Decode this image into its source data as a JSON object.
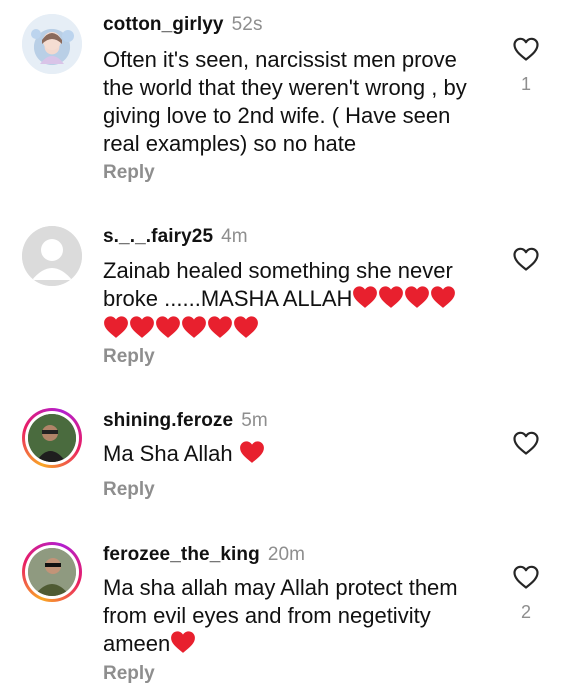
{
  "comments": [
    {
      "username": "cotton_girlyy",
      "time": "52s",
      "text_lines": [
        "Often it's seen, narcissist men prove",
        "the world that they weren't wrong , by",
        "giving love to 2nd wife. ( Have seen",
        "real examples) so no hate"
      ],
      "reply_label": "Reply",
      "like_count": "1"
    },
    {
      "username": "s._._.fairy25",
      "time": "4m",
      "text_line1": "Zainab healed something she never",
      "text_line2": "broke ......MASHA ALLAH",
      "reply_label": "Reply",
      "like_count": ""
    },
    {
      "username": "shining.feroze",
      "time": "5m",
      "text": "Ma Sha Allah",
      "reply_label": "Reply",
      "like_count": ""
    },
    {
      "username": "ferozee_the_king",
      "time": "20m",
      "text_lines": [
        "Ma sha allah may Allah protect them",
        "from evil eyes and from negetivity"
      ],
      "text_last": "ameen",
      "reply_label": "Reply",
      "like_count": "2"
    }
  ],
  "colors": {
    "heart_emoji": "#e8202e",
    "muted": "#8e8e8e",
    "story_ring": "#e91e63"
  }
}
